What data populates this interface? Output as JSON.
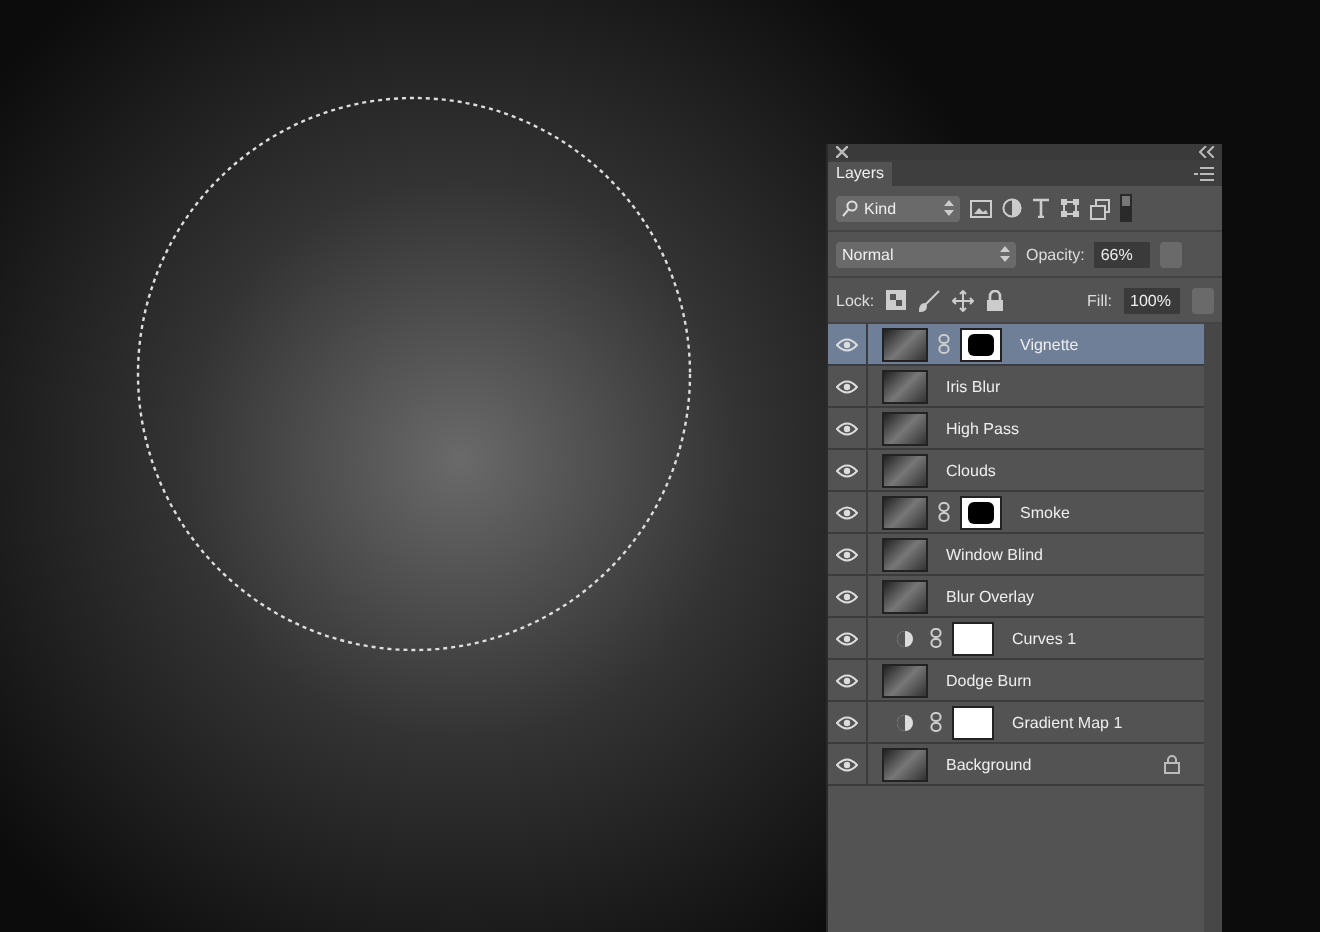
{
  "panel": {
    "tab": {
      "label": "Layers",
      "selected": true
    },
    "filter": {
      "value": "Kind"
    },
    "blend_mode": {
      "value": "Normal"
    },
    "opacity": {
      "label": "Opacity:",
      "value": "66%"
    },
    "lock": {
      "label": "Lock:"
    },
    "fill": {
      "label": "Fill:",
      "value": "100%"
    },
    "layers": [
      {
        "name": "Vignette",
        "kind": "masked",
        "visible": true,
        "selected": true,
        "locked": false
      },
      {
        "name": "Iris Blur",
        "kind": "pixel",
        "visible": true,
        "selected": false,
        "locked": false
      },
      {
        "name": "High Pass",
        "kind": "pixel",
        "visible": true,
        "selected": false,
        "locked": false
      },
      {
        "name": "Clouds",
        "kind": "pixel",
        "visible": true,
        "selected": false,
        "locked": false
      },
      {
        "name": "Smoke",
        "kind": "masked",
        "visible": true,
        "selected": false,
        "locked": false
      },
      {
        "name": "Window Blind",
        "kind": "pixel",
        "visible": true,
        "selected": false,
        "locked": false
      },
      {
        "name": "Blur Overlay",
        "kind": "pixel",
        "visible": true,
        "selected": false,
        "locked": false
      },
      {
        "name": "Curves 1",
        "kind": "adjustment",
        "visible": true,
        "selected": false,
        "locked": false
      },
      {
        "name": "Dodge Burn",
        "kind": "pixel",
        "visible": true,
        "selected": false,
        "locked": false
      },
      {
        "name": "Gradient Map 1",
        "kind": "adjustment",
        "visible": true,
        "selected": false,
        "locked": false
      },
      {
        "name": "Background",
        "kind": "pixel",
        "visible": true,
        "selected": false,
        "locked": true
      }
    ]
  }
}
